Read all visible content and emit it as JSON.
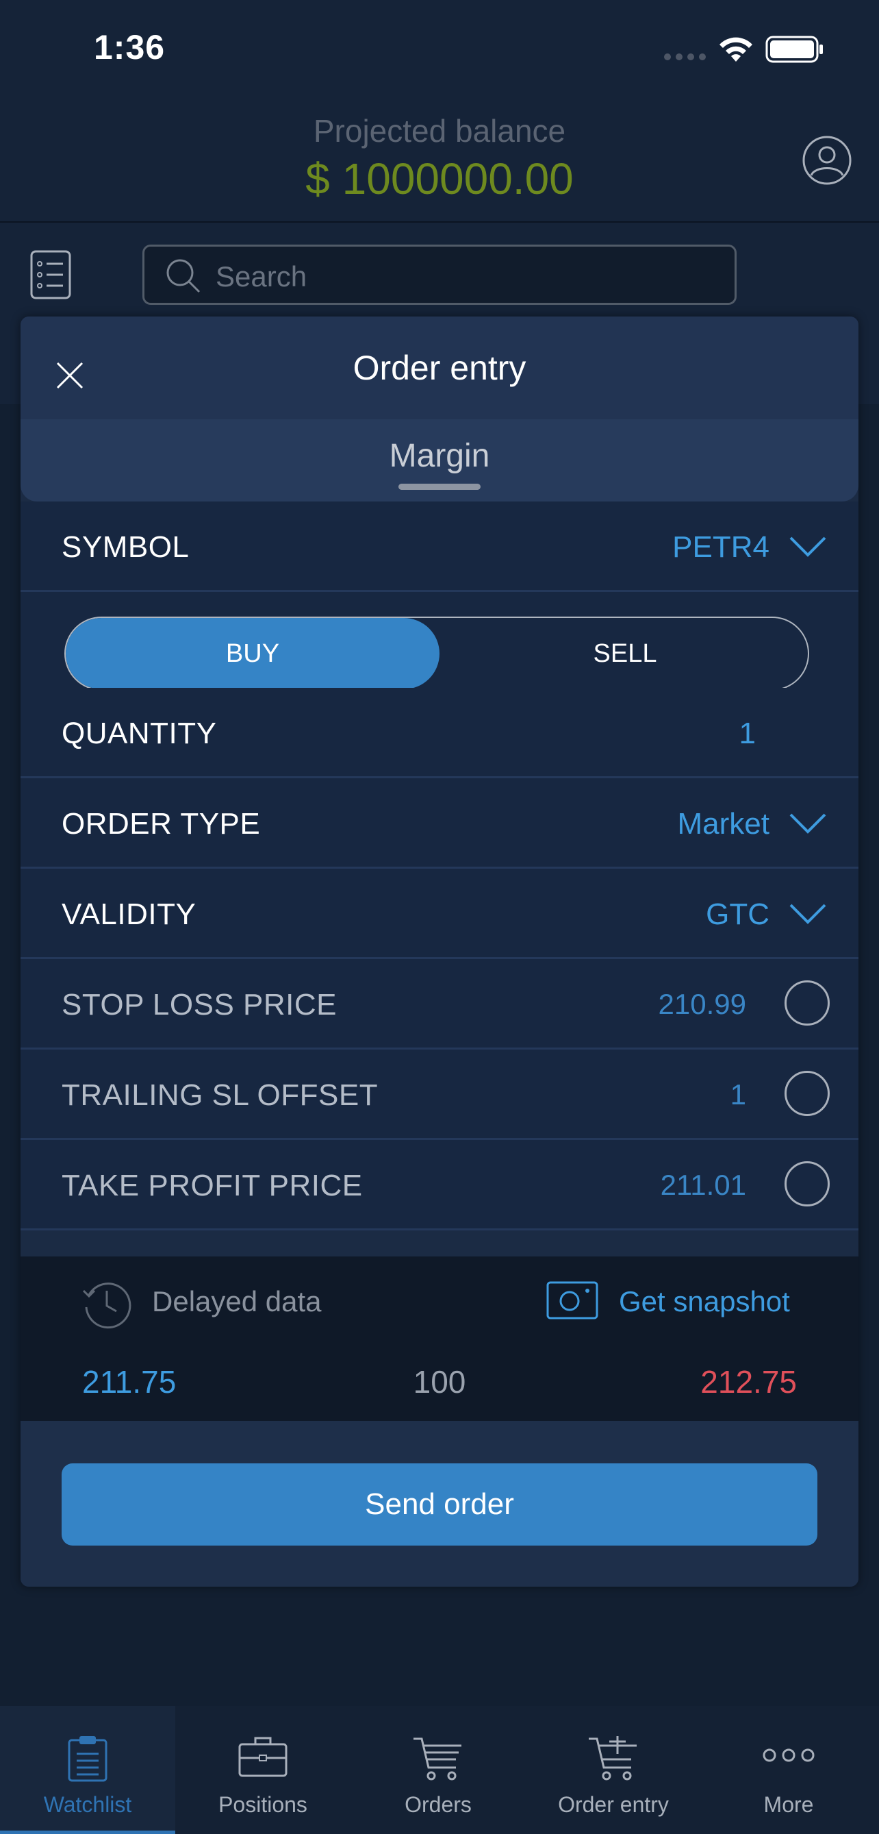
{
  "status_bar": {
    "time": "1:36"
  },
  "header": {
    "balance_label": "Projected balance",
    "balance_value": "$ 1000000.00"
  },
  "search": {
    "placeholder": "Search"
  },
  "order_entry": {
    "title": "Order entry",
    "mode_tab": "Margin",
    "symbol": {
      "label": "SYMBOL",
      "value": "PETR4"
    },
    "side": {
      "buy_label": "BUY",
      "sell_label": "SELL",
      "selected": "BUY"
    },
    "quantity": {
      "label": "QUANTITY",
      "value": "1"
    },
    "order_type": {
      "label": "ORDER TYPE",
      "value": "Market"
    },
    "validity": {
      "label": "VALIDITY",
      "value": "GTC"
    },
    "stop_loss": {
      "label": "STOP LOSS PRICE",
      "value": "210.99"
    },
    "trailing_sl": {
      "label": "TRAILING SL OFFSET",
      "value": "1"
    },
    "take_profit": {
      "label": "TAKE PROFIT PRICE",
      "value": "211.01"
    },
    "market_data": {
      "delayed_label": "Delayed data",
      "snapshot_label": "Get snapshot",
      "bid": "211.75",
      "size": "100",
      "ask": "212.75"
    },
    "send_label": "Send order"
  },
  "tab_bar": {
    "tabs": [
      {
        "label": "Watchlist",
        "icon": "clipboard-icon",
        "active": true
      },
      {
        "label": "Positions",
        "icon": "briefcase-icon",
        "active": false
      },
      {
        "label": "Orders",
        "icon": "cart-icon",
        "active": false
      },
      {
        "label": "Order entry",
        "icon": "cart-add-icon",
        "active": false
      },
      {
        "label": "More",
        "icon": "more-dots-icon",
        "active": false
      }
    ]
  },
  "colors": {
    "background": "#152338",
    "accent": "#3584c6",
    "balance": "#6e8a1f",
    "ask": "#e0505a",
    "link": "#3e9ce0"
  }
}
